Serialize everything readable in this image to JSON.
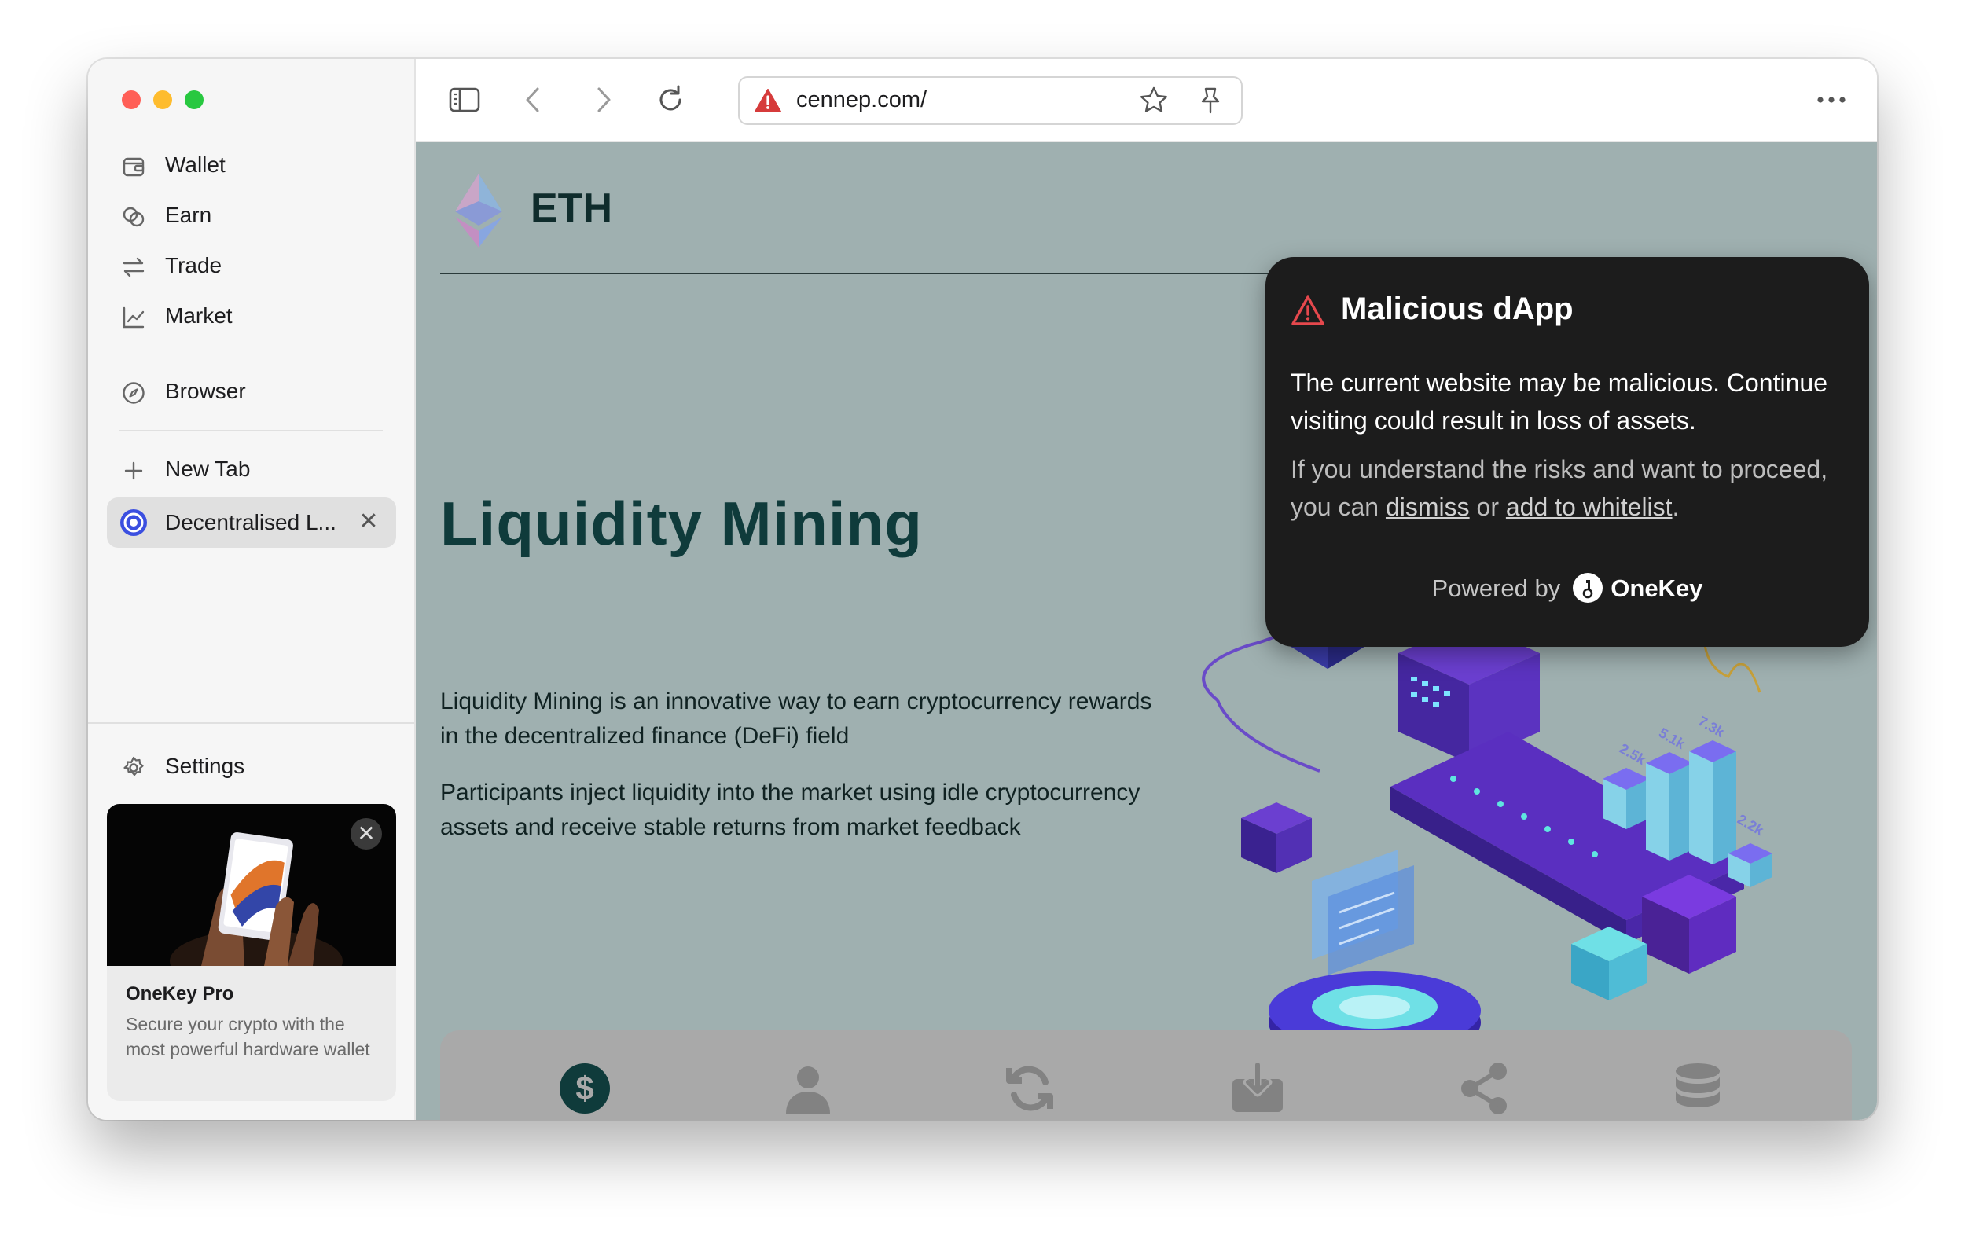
{
  "sidebar": {
    "nav": [
      {
        "label": "Wallet",
        "icon": "wallet-icon"
      },
      {
        "label": "Earn",
        "icon": "earn-icon"
      },
      {
        "label": "Trade",
        "icon": "trade-icon"
      },
      {
        "label": "Market",
        "icon": "market-icon"
      }
    ],
    "browser": {
      "label": "Browser",
      "icon": "compass-icon"
    },
    "new_tab": {
      "label": "New Tab",
      "icon": "plus-icon"
    },
    "open_tab": {
      "label": "Decentralised L...",
      "icon": "site-favicon"
    },
    "settings": {
      "label": "Settings",
      "icon": "gear-icon"
    },
    "promo": {
      "title": "OneKey Pro",
      "text": "Secure your crypto with the most powerful hardware wallet"
    }
  },
  "toolbar": {
    "url": "cennep.com/"
  },
  "page": {
    "logo_text": "ETH",
    "title": "Liquidity Mining",
    "paragraph1": "Liquidity Mining is an innovative way to earn cryptocurrency rewards in the decentralized finance (DeFi) field",
    "paragraph2": "Participants inject liquidity into the market using idle cryptocurrency assets and receive stable returns from market feedback",
    "illustration_labels": [
      "2.5k",
      "5.1k",
      "7.3k",
      "2.2k"
    ]
  },
  "popup": {
    "title": "Malicious dApp",
    "message": "The current website may be malicious. Continue visiting could result in loss of assets.",
    "hint_prefix": "If you understand the risks and want to proceed, you can",
    "dismiss": "dismiss",
    "or": "or",
    "whitelist": "add to whitelist",
    "period": ".",
    "powered_by": "Powered by",
    "brand": "OneKey"
  },
  "colors": {
    "page_background": "#9fb0b0",
    "heading": "#0f3b3b",
    "popup_background": "#1c1c1c",
    "warning_red": "#e5484d",
    "close_red": "#ff5f57",
    "minimize_yellow": "#febc2e",
    "zoom_green": "#28c840"
  }
}
